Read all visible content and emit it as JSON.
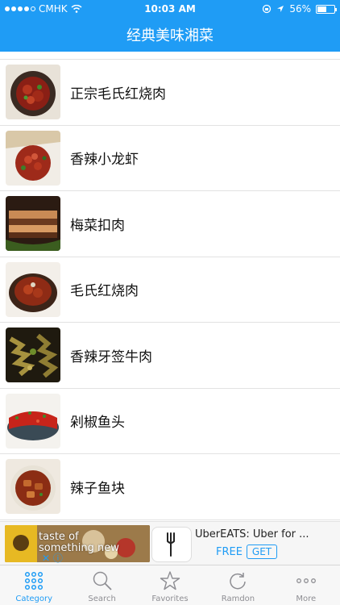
{
  "status_bar": {
    "carrier": "CMHK",
    "time": "10:03 AM",
    "battery_percent": "56%",
    "battery_level": 0.56
  },
  "nav": {
    "title": "经典美味湘菜"
  },
  "list": {
    "items": [
      {
        "title": "正宗毛氏红烧肉"
      },
      {
        "title": "香辣小龙虾"
      },
      {
        "title": "梅菜扣肉"
      },
      {
        "title": "毛氏红烧肉"
      },
      {
        "title": "香辣牙签牛肉"
      },
      {
        "title": "剁椒鱼头"
      },
      {
        "title": "辣子鱼块"
      }
    ]
  },
  "ad": {
    "image_text_line1": "taste of",
    "image_text_line2": "something new",
    "app_name": "UberEATS: Uber for ...",
    "free_label": "FREE",
    "get_label": "GET"
  },
  "tabbar": {
    "items": [
      {
        "label": "Category",
        "icon": "grid-icon"
      },
      {
        "label": "Search",
        "icon": "search-icon"
      },
      {
        "label": "Favorites",
        "icon": "star-icon"
      },
      {
        "label": "Ramdon",
        "icon": "refresh-icon"
      },
      {
        "label": "More",
        "icon": "more-icon"
      }
    ]
  },
  "colors": {
    "accent": "#1f9cf5"
  }
}
